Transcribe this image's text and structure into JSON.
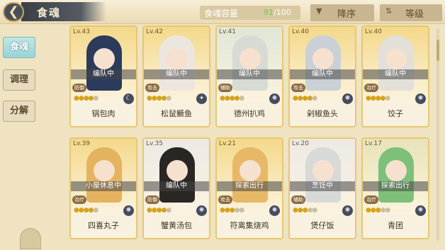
{
  "header": {
    "title": "食魂",
    "capacity_label": "食魂容量",
    "capacity_current": "91",
    "capacity_total": "/100",
    "sort_order_label": "降序",
    "sort_by_label": "等级"
  },
  "tabs": [
    {
      "label": "食魂",
      "active": true
    },
    {
      "label": "调理",
      "active": false
    },
    {
      "label": "分解",
      "active": false
    }
  ],
  "cards": [
    {
      "level": "Lv.43",
      "status": "编队中",
      "role": "防御",
      "name": "锅包肉",
      "stars": 4,
      "element_icon": "moon-icon",
      "hair": "#2c3a5c",
      "bg": "#f4d98a"
    },
    {
      "level": "Lv.42",
      "status": "编队中",
      "role": "攻击",
      "name": "松鼠鳜鱼",
      "stars": 4,
      "element_icon": "star-icon",
      "hair": "#ede6df",
      "bg": "#f4d98a"
    },
    {
      "level": "Lv.41",
      "status": "编队中",
      "role": "辅助",
      "name": "德州扒鸡",
      "stars": 4,
      "element_icon": "sun-icon",
      "hair": "#d8dad4",
      "bg": "#dfe7d7"
    },
    {
      "level": "Lv.40",
      "status": "编队中",
      "role": "攻击",
      "name": "剁椒鱼头",
      "stars": 4,
      "element_icon": "sun-icon",
      "hair": "#c9d0d6",
      "bg": "#f4d98a"
    },
    {
      "level": "Lv.40",
      "status": "编队中",
      "role": "治疗",
      "name": "饺子",
      "stars": 4,
      "element_icon": "sun-icon",
      "hair": "#e3e0da",
      "bg": "#f4d98a"
    },
    {
      "level": "Lv.39",
      "status": "小屋休息中",
      "role": "治疗",
      "name": "四喜丸子",
      "stars": 4,
      "element_icon": "sun-icon",
      "hair": "#e4b35f",
      "bg": "#f4d98a"
    },
    {
      "level": "Lv.35",
      "status": "编队中",
      "role": "防御",
      "name": "蟹黄汤包",
      "stars": 4,
      "element_icon": "sun-icon",
      "hair": "#2a2623",
      "bg": "#eceae6"
    },
    {
      "level": "Lv.21",
      "status": "探索出行",
      "role": "攻击",
      "name": "符离集烧鸡",
      "stars": 3,
      "element_icon": "sun-icon",
      "hair": "#e7b866",
      "bg": "#f4d98a"
    },
    {
      "level": "Lv.20",
      "status": "烹饪中",
      "role": "辅助",
      "name": "煲仔饭",
      "stars": 3,
      "element_icon": "sun-icon",
      "hair": "#d7dad7",
      "bg": "#eceae6"
    },
    {
      "level": "Lv.17",
      "status": "探索出行",
      "role": "治疗",
      "name": "青团",
      "stars": 3,
      "element_icon": "sun-icon",
      "hair": "#7ec07a",
      "bg": "#e8e3b8"
    }
  ]
}
